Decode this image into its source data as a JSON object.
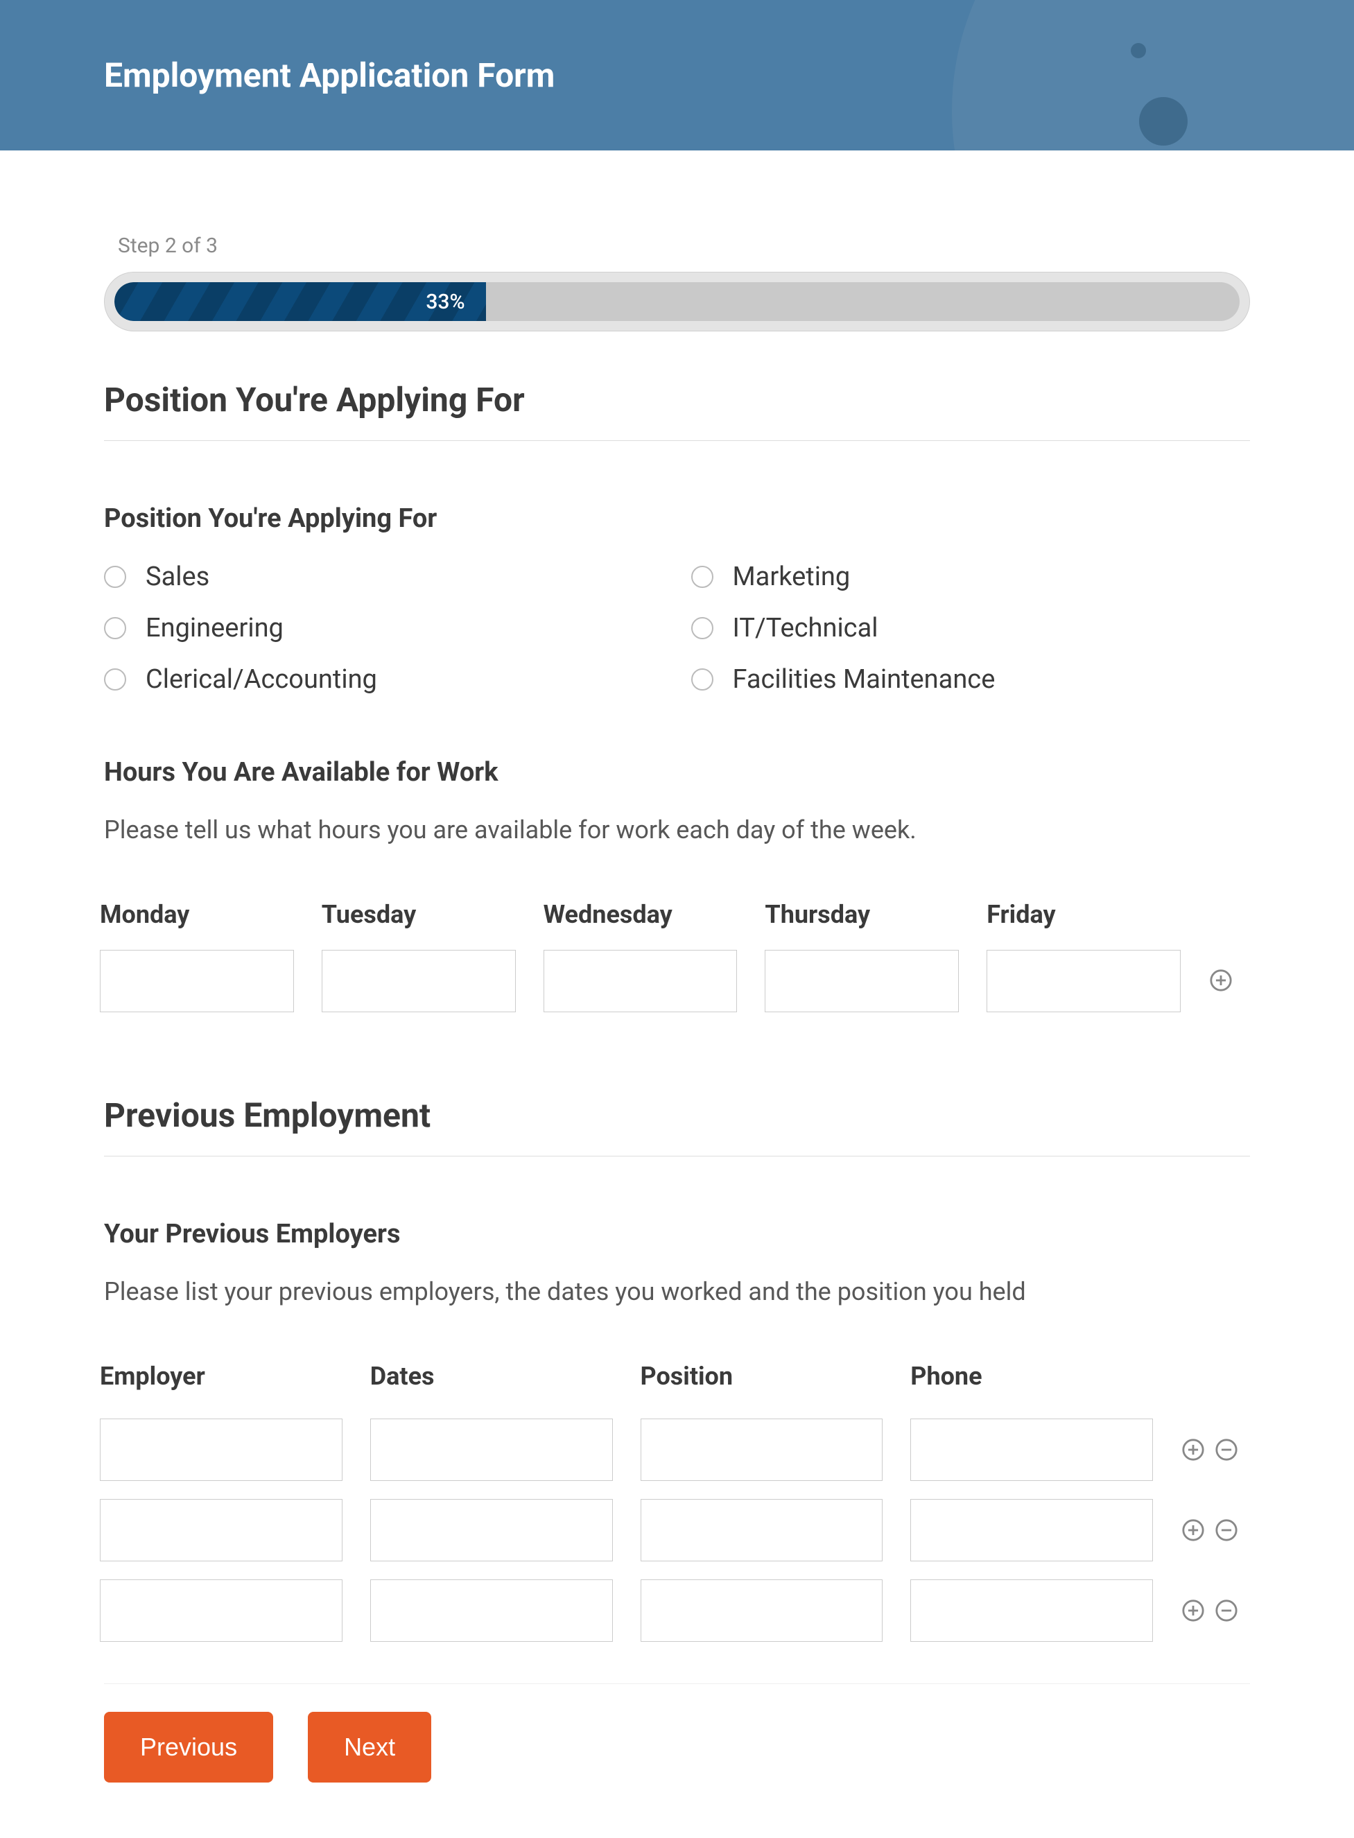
{
  "header": {
    "title": "Employment Application Form"
  },
  "progress": {
    "step_label": "Step 2 of 3",
    "percent_label": "33%",
    "percent_value": 33
  },
  "section_position": {
    "title": "Position You're Applying For",
    "question_label": "Position You're Applying For",
    "options": [
      "Sales",
      "Marketing",
      "Engineering",
      "IT/Technical",
      "Clerical/Accounting",
      "Facilities Maintenance"
    ]
  },
  "hours": {
    "label": "Hours You Are Available for Work",
    "helper": "Please tell us what hours you are available for work each day of the week.",
    "days": [
      "Monday",
      "Tuesday",
      "Wednesday",
      "Thursday",
      "Friday"
    ],
    "values": [
      "",
      "",
      "",
      "",
      ""
    ]
  },
  "section_previous": {
    "title": "Previous Employment",
    "label": "Your Previous Employers",
    "helper": "Please list your previous employers, the dates you worked and the position you held",
    "columns": [
      "Employer",
      "Dates",
      "Position",
      "Phone"
    ],
    "rows": [
      {
        "employer": "",
        "dates": "",
        "position": "",
        "phone": ""
      },
      {
        "employer": "",
        "dates": "",
        "position": "",
        "phone": ""
      },
      {
        "employer": "",
        "dates": "",
        "position": "",
        "phone": ""
      }
    ]
  },
  "buttons": {
    "previous": "Previous",
    "next": "Next"
  }
}
